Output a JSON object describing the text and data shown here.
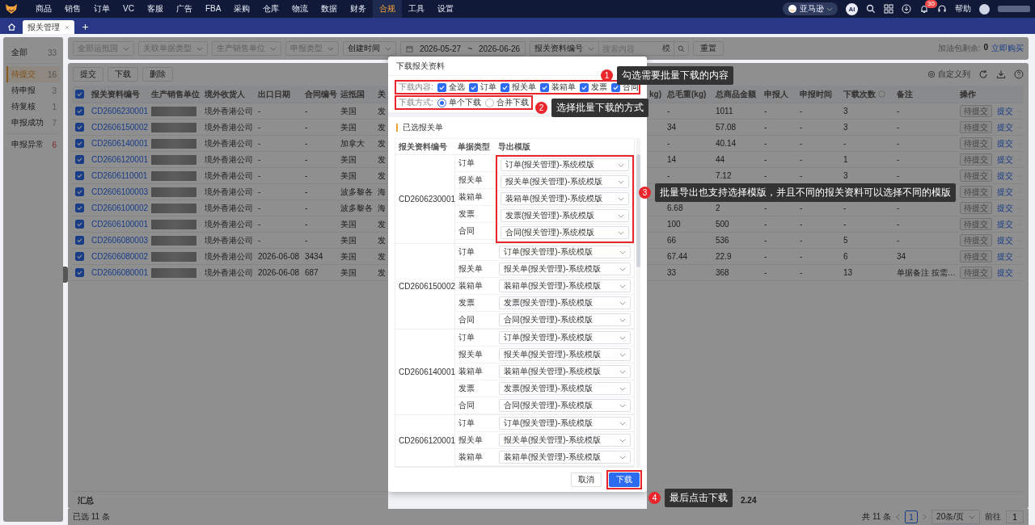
{
  "nav": {
    "items": [
      {
        "label": "商品",
        "selected": false
      },
      {
        "label": "销售",
        "selected": false
      },
      {
        "label": "订单",
        "selected": false
      },
      {
        "label": "VC",
        "selected": false
      },
      {
        "label": "客服",
        "selected": false
      },
      {
        "label": "广告",
        "selected": false
      },
      {
        "label": "FBA",
        "selected": false
      },
      {
        "label": "采购",
        "selected": false
      },
      {
        "label": "仓库",
        "selected": false
      },
      {
        "label": "物流",
        "selected": false
      },
      {
        "label": "数据",
        "selected": false
      },
      {
        "label": "财务",
        "selected": false
      },
      {
        "label": "合规",
        "selected": true
      },
      {
        "label": "工具",
        "selected": false
      },
      {
        "label": "设置",
        "selected": false
      }
    ],
    "store": "亚马逊",
    "ai": "AI",
    "badge": "30",
    "help": "帮助"
  },
  "tabs": [
    {
      "label": "报关管理",
      "selected": true
    }
  ],
  "sidebar": {
    "groups": [
      {
        "items": [
          {
            "label": "全部",
            "count": "33",
            "selected": false,
            "alert": false
          }
        ]
      },
      {
        "items": [
          {
            "label": "待提交",
            "count": "16",
            "selected": true,
            "alert": false
          },
          {
            "label": "待申报",
            "count": "3",
            "selected": false,
            "alert": false
          },
          {
            "label": "待复核",
            "count": "1",
            "selected": false,
            "alert": false
          },
          {
            "label": "申报成功",
            "count": "7",
            "selected": false,
            "alert": false
          }
        ]
      },
      {
        "items": [
          {
            "label": "申报异常",
            "count": "6",
            "selected": false,
            "alert": true
          }
        ]
      }
    ]
  },
  "filters": {
    "selects": [
      "全部运抵国",
      "关联单据类型",
      "生产销售单位",
      "申报类型"
    ],
    "time_field": "创建时间",
    "date_from": "2026-05-27",
    "date_sep": "~",
    "date_to": "2026-06-26",
    "search_field": "报关资料编号",
    "search_placeholder": "搜索内容",
    "search_mode": "模",
    "reset": "重置"
  },
  "quota": {
    "label": "加油包剩余:",
    "value": "0",
    "link": "立即购买"
  },
  "toolbar": {
    "buttons": [
      "提交",
      "下载",
      "删除"
    ],
    "custom_columns": "自定义列"
  },
  "table": {
    "all_selected": true,
    "left_columns": [
      "报关资料编号",
      "生产销售单位",
      "境外收货人",
      "出口日期",
      "合同编号",
      "运抵国",
      "关"
    ],
    "right_columns": [
      "kg)",
      "总毛重(kg)",
      "总商品金额",
      "申报人",
      "申报时间",
      "下载次数",
      "备注",
      "操作"
    ],
    "rows": [
      {
        "selected": true,
        "id": "CD2606230001",
        "unit_redacted": true,
        "consignee": "境外香港公司",
        "export_date": "-",
        "contract": "-",
        "country": "美国",
        "column_7": "发",
        "gross": "-",
        "amount": "1011",
        "declarant": "-",
        "declared_at": "-",
        "downloads": "3",
        "remark": "-",
        "status": "待提交",
        "action": "提交"
      },
      {
        "selected": true,
        "id": "CD2606150002",
        "unit_redacted": true,
        "consignee": "境外香港公司",
        "export_date": "-",
        "contract": "-",
        "country": "美国",
        "column_7": "发",
        "gross": "34",
        "amount": "57.08",
        "declarant": "-",
        "declared_at": "-",
        "downloads": "3",
        "remark": "-",
        "status": "待提交",
        "action": "提交"
      },
      {
        "selected": true,
        "id": "CD2606140001",
        "unit_redacted": true,
        "consignee": "境外香港公司",
        "export_date": "-",
        "contract": "-",
        "country": "加拿大",
        "column_7": "发",
        "gross": "-",
        "amount": "40.14",
        "declarant": "-",
        "declared_at": "-",
        "downloads": "-",
        "remark": "-",
        "status": "待提交",
        "action": "提交"
      },
      {
        "selected": true,
        "id": "CD2606120001",
        "unit_redacted": true,
        "consignee": "境外香港公司",
        "export_date": "-",
        "contract": "-",
        "country": "美国",
        "column_7": "发",
        "gross": "14",
        "amount": "44",
        "declarant": "-",
        "declared_at": "-",
        "downloads": "1",
        "remark": "-",
        "status": "待提交",
        "action": "提交"
      },
      {
        "selected": true,
        "id": "CD2606110001",
        "unit_redacted": true,
        "consignee": "境外香港公司",
        "export_date": "-",
        "contract": "-",
        "country": "美国",
        "column_7": "发",
        "gross": "-",
        "amount": "7.12",
        "declarant": "-",
        "declared_at": "-",
        "downloads": "3",
        "remark": "-",
        "status": "待提交",
        "action": "提交"
      },
      {
        "selected": true,
        "id": "CD2606100003",
        "unit_redacted": true,
        "consignee": "境外香港公司",
        "export_date": "-",
        "contract": "-",
        "country": "波多黎各",
        "column_7": "海",
        "status": "待提交",
        "action": "提交"
      },
      {
        "selected": true,
        "id": "CD2606100002",
        "unit_redacted": true,
        "consignee": "境外香港公司",
        "export_date": "-",
        "contract": "-",
        "country": "波多黎各",
        "column_7": "海",
        "gross": "6.68",
        "amount": "2",
        "declarant": "-",
        "declared_at": "-",
        "downloads": "-",
        "remark": "-",
        "status": "待提交",
        "action": "提交"
      },
      {
        "selected": true,
        "id": "CD2606100001",
        "unit_redacted": true,
        "consignee": "境外香港公司",
        "export_date": "-",
        "contract": "-",
        "country": "美国",
        "column_7": "发",
        "gross": "100",
        "amount": "500",
        "declarant": "-",
        "declared_at": "-",
        "downloads": "-",
        "remark": "-",
        "status": "待提交",
        "action": "提交"
      },
      {
        "selected": true,
        "id": "CD2606080003",
        "unit_redacted": true,
        "consignee": "境外香港公司",
        "export_date": "-",
        "contract": "-",
        "country": "美国",
        "column_7": "发",
        "gross": "66",
        "amount": "536",
        "declarant": "-",
        "declared_at": "-",
        "downloads": "5",
        "remark": "-",
        "status": "待提交",
        "action": "提交"
      },
      {
        "selected": true,
        "id": "CD2606080002",
        "unit_redacted": true,
        "consignee": "境外香港公司",
        "export_date": "2026-06-08",
        "contract": "3434",
        "country": "美国",
        "column_7": "发",
        "gross": "67.44",
        "amount": "22.9",
        "declarant": "-",
        "declared_at": "-",
        "downloads": "6",
        "remark": "34",
        "status": "待提交",
        "action": "提交"
      },
      {
        "selected": true,
        "id": "CD2606080001",
        "unit_redacted": true,
        "consignee": "境外香港公司",
        "export_date": "2026-06-08",
        "contract": "687",
        "country": "美国",
        "column_7": "发",
        "gross": "33",
        "amount": "368",
        "declarant": "-",
        "declared_at": "-",
        "downloads": "13",
        "remark": "单据备注 按需…",
        "status": "待提交",
        "action": "提交"
      }
    ],
    "summary_label": "汇总",
    "summary_value": "2.24",
    "selected_count": "已选 11 条"
  },
  "pagination": {
    "total": "共 11 条",
    "pages": [
      {
        "label": "1",
        "selected": true
      }
    ],
    "page_size": "20条/页",
    "goto": "前往",
    "page_input": "1"
  },
  "modal": {
    "title": "下载报关资料",
    "content_label": "下载内容:",
    "content_options": [
      {
        "label": "全选",
        "checked": true
      },
      {
        "label": "订单",
        "checked": true
      },
      {
        "label": "报关单",
        "checked": true
      },
      {
        "label": "装箱单",
        "checked": true
      },
      {
        "label": "发票",
        "checked": true
      },
      {
        "label": "合同",
        "checked": true
      }
    ],
    "method_label": "下载方式:",
    "methods": [
      {
        "label": "单个下载",
        "selected": true
      },
      {
        "label": "合并下载",
        "selected": false
      }
    ],
    "section_title": "已选报关单",
    "columns": [
      "报关资料编号",
      "单据类型",
      "导出模版"
    ],
    "groups": [
      {
        "id": "CD2606230001",
        "docs": [
          {
            "type": "订单",
            "template": "订单(报关管理)-系统模版"
          },
          {
            "type": "报关单",
            "template": "报关单(报关管理)-系统模版"
          },
          {
            "type": "装箱单",
            "template": "装箱单(报关管理)-系统模版"
          },
          {
            "type": "发票",
            "template": "发票(报关管理)-系统模版"
          },
          {
            "type": "合同",
            "template": "合同(报关管理)-系统模版"
          }
        ]
      },
      {
        "id": "CD2606150002",
        "docs": [
          {
            "type": "订单",
            "template": "订单(报关管理)-系统模版"
          },
          {
            "type": "报关单",
            "template": "报关单(报关管理)-系统模版"
          },
          {
            "type": "装箱单",
            "template": "装箱单(报关管理)-系统模版"
          },
          {
            "type": "发票",
            "template": "发票(报关管理)-系统模版"
          },
          {
            "type": "合同",
            "template": "合同(报关管理)-系统模版"
          }
        ]
      },
      {
        "id": "CD2606140001",
        "docs": [
          {
            "type": "订单",
            "template": "订单(报关管理)-系统模版"
          },
          {
            "type": "报关单",
            "template": "报关单(报关管理)-系统模版"
          },
          {
            "type": "装箱单",
            "template": "装箱单(报关管理)-系统模版"
          },
          {
            "type": "发票",
            "template": "发票(报关管理)-系统模版"
          },
          {
            "type": "合同",
            "template": "合同(报关管理)-系统模版"
          }
        ]
      },
      {
        "id": "CD2606120001",
        "docs": [
          {
            "type": "订单",
            "template": "订单(报关管理)-系统模版"
          },
          {
            "type": "报关单",
            "template": "报关单(报关管理)-系统模版"
          },
          {
            "type": "装箱单",
            "template": "装箱单(报关管理)-系统模版"
          }
        ]
      }
    ],
    "buttons": [
      {
        "label": "取消",
        "kind": "default"
      },
      {
        "label": "下载",
        "kind": "primary"
      }
    ]
  },
  "annotations": [
    {
      "number": "1",
      "text": "勾选需要批量下载的内容"
    },
    {
      "number": "2",
      "text": "选择批量下载的方式"
    },
    {
      "number": "3",
      "text": "批量导出也支持选择模版，并且不同的报关资料可以选择不同的模版"
    },
    {
      "number": "4",
      "text": "最后点击下载"
    }
  ]
}
